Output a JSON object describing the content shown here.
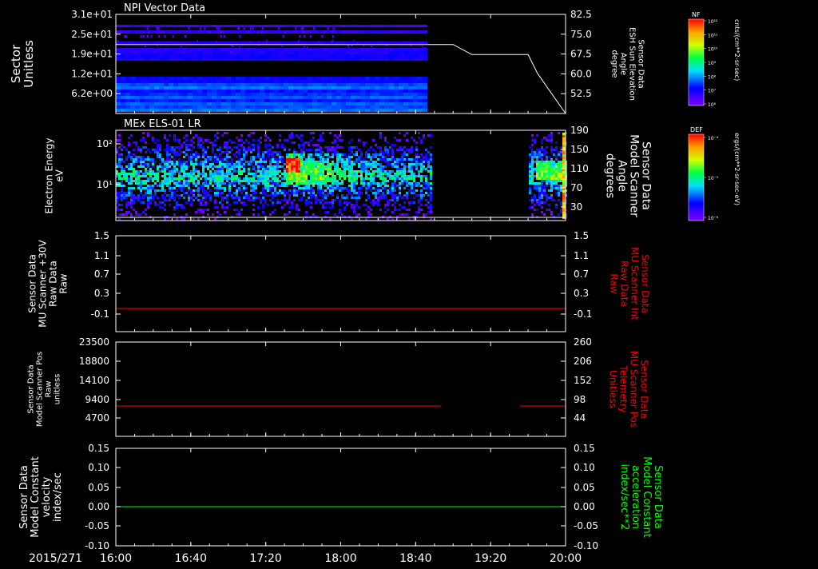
{
  "date_label": "2015/271",
  "time_ticks": [
    "16:00",
    "16:40",
    "17:20",
    "18:00",
    "18:40",
    "19:20",
    "20:00"
  ],
  "panel1": {
    "title": "NPI Vector Data",
    "ylabel": [
      "Sector",
      "Unitless"
    ],
    "yticks": [
      "3.1e+01",
      "2.5e+01",
      "1.9e+01",
      "1.2e+01",
      "6.2e+00"
    ],
    "rlabel": [
      "Sensor Data",
      "ESH Sun Elevation",
      "Angle",
      "degree"
    ],
    "rticks": [
      "82.5",
      "75.0",
      "67.5",
      "60.0",
      "52.5"
    ],
    "cb_label": "NF",
    "cb_units": "cnts/(cm**2-sr-sec)",
    "cb_ticks": [
      "10¹²",
      "10¹¹",
      "10¹⁰",
      "10⁹",
      "10⁸",
      "10⁷",
      "10⁶"
    ]
  },
  "panel2": {
    "title": "MEx ELS-01 LR",
    "ylabel": [
      "Electron Energy",
      "eV"
    ],
    "yticks": [
      "10²",
      "10¹"
    ],
    "rlabel": [
      "Sensor Data",
      "Model Scanner",
      "Angle",
      "degrees"
    ],
    "rticks": [
      "190",
      "150",
      "110",
      "70",
      "30"
    ],
    "cb_label": "DEF",
    "cb_units": "ergs/(cm**2-sr-sec-eV)",
    "cb_ticks": [
      "10⁻⁴",
      "10⁻⁵",
      "10⁻⁶"
    ]
  },
  "panel3": {
    "ylabel": [
      "Sensor Data",
      "MU Scanner +30V",
      "Raw Data",
      "Raw"
    ],
    "yticks": [
      "1.5",
      "1.1",
      "0.7",
      "0.3",
      "-0.1"
    ],
    "rlabel": [
      "Sensor Data",
      "MU Scanner Int",
      "Raw Data",
      "Raw"
    ],
    "rticks": [
      "1.5",
      "1.1",
      "0.7",
      "0.3",
      "-0.1"
    ]
  },
  "panel4": {
    "ylabel": [
      "Sensor Data",
      "Model Scanner Pos",
      "Raw",
      "unitless"
    ],
    "yticks": [
      "23500",
      "18800",
      "14100",
      "9400",
      "4700"
    ],
    "rlabel": [
      "Sensor Data",
      "MU Scanner Pos",
      "Telemetry",
      "Unitless"
    ],
    "rticks": [
      "260",
      "206",
      "152",
      "98",
      "44"
    ]
  },
  "panel5": {
    "ylabel": [
      "Sensor Data",
      "Model Constant",
      "velocity",
      "index/sec"
    ],
    "yticks": [
      "0.15",
      "0.10",
      "0.05",
      "0.00",
      "-0.05",
      "-0.10"
    ],
    "rlabel": [
      "Sensor Data",
      "Model Constant",
      "acceleration",
      "index/sec**2"
    ],
    "rticks": [
      "0.15",
      "0.10",
      "0.05",
      "0.00",
      "-0.05",
      "-0.10"
    ]
  },
  "colors": {
    "red_axis": "#ff0000",
    "green_axis": "#00ff00",
    "white": "#ffffff"
  },
  "chart_data": [
    {
      "type": "heatmap",
      "title": "NPI Vector Data",
      "x_range": [
        "16:00",
        "20:00"
      ],
      "data_end": "18:50",
      "ylim_left": [
        0,
        31
      ],
      "overlay_line": {
        "name": "Sensor Data ESH Sun Elevation Angle",
        "units": "degree",
        "x": [
          "16:00",
          "19:00",
          "19:10",
          "19:40",
          "19:45",
          "20:00"
        ],
        "y": [
          72.0,
          72.0,
          68.5,
          68.5,
          62.0,
          48.0
        ],
        "ylim": [
          48,
          82.5
        ]
      }
    },
    {
      "type": "heatmap",
      "title": "MEx ELS-01 LR",
      "x_range": [
        "16:00",
        "20:00"
      ],
      "data_intervals": [
        [
          "16:00",
          "18:48"
        ],
        [
          "19:33",
          "20:00"
        ]
      ],
      "ylabel": "Electron Energy eV",
      "y_scale": "log",
      "overlay_line": {
        "name": "Sensor Data Model Scanner Angle",
        "y": 12,
        "ylim": [
          0,
          190
        ]
      }
    },
    {
      "type": "line",
      "series": [
        {
          "x": [
            "16:00",
            "20:00"
          ],
          "y": [
            0.0,
            0.0
          ],
          "color": "#ff0000"
        }
      ],
      "ylim": [
        -0.3,
        1.5
      ]
    },
    {
      "type": "line",
      "series": [
        {
          "x": [
            "16:00",
            "18:50"
          ],
          "y": [
            8100,
            8100
          ],
          "color": "#ff0000"
        },
        {
          "x": [
            "19:35",
            "20:00"
          ],
          "y": [
            8100,
            8100
          ],
          "color": "#ff0000"
        }
      ],
      "ylim": [
        0,
        23500
      ]
    },
    {
      "type": "line",
      "series": [
        {
          "x": [
            "16:00",
            "20:00"
          ],
          "y": [
            0.0,
            0.0
          ],
          "color": "#00ff00"
        }
      ],
      "ylim": [
        -0.1,
        0.15
      ]
    }
  ]
}
